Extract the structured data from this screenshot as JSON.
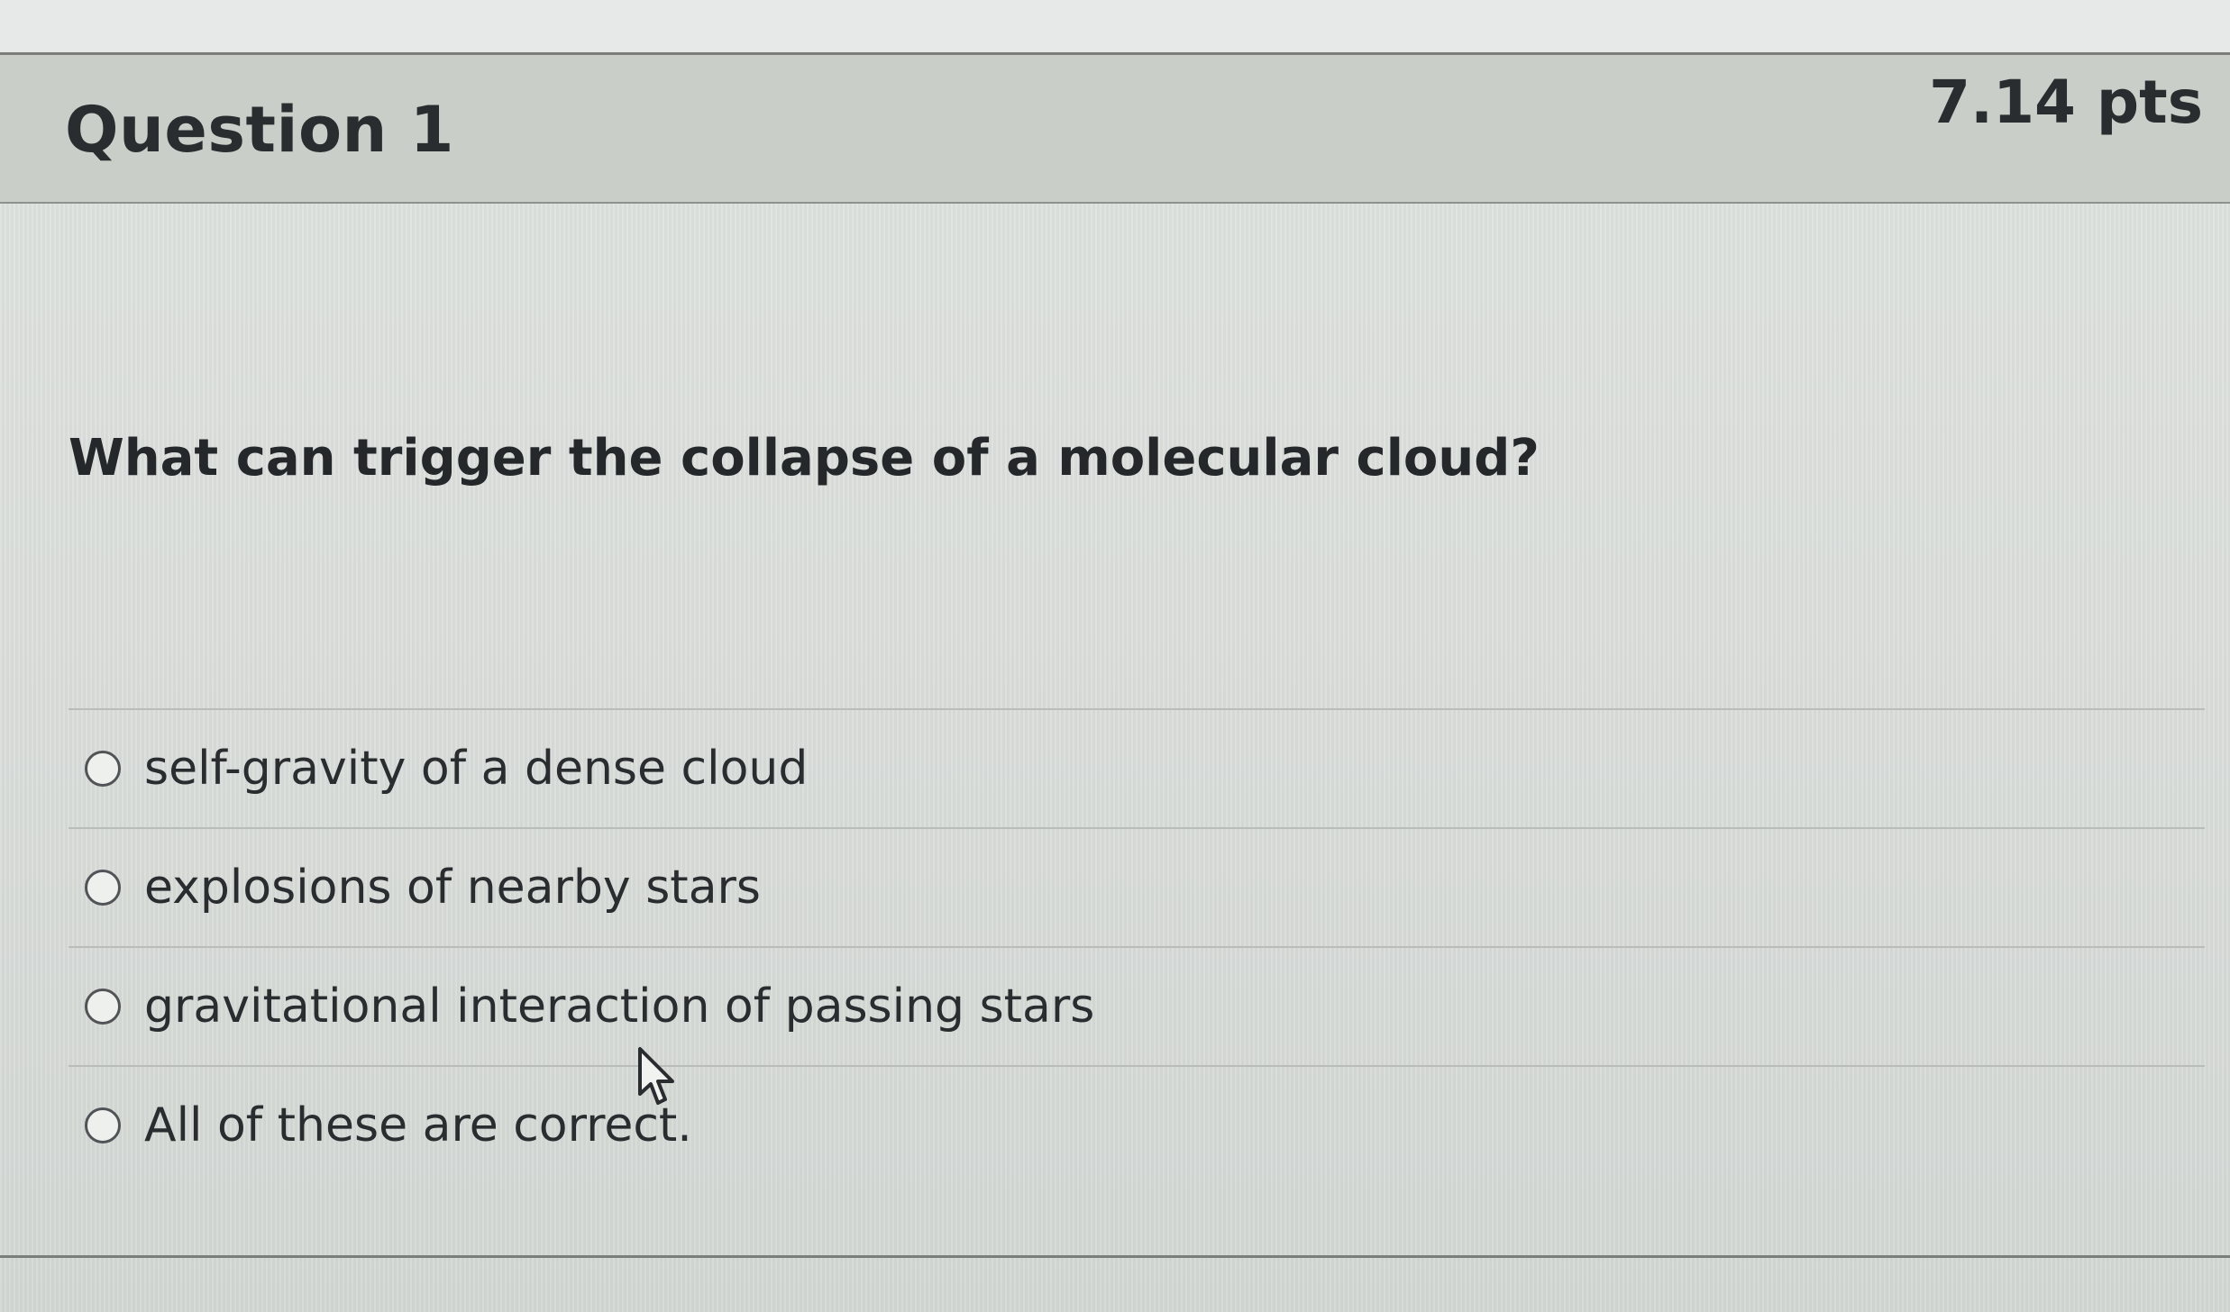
{
  "question": {
    "title": "Question 1",
    "points": "7.14 pts",
    "text": "What can trigger the collapse of a molecular cloud?"
  },
  "answers": [
    {
      "label": "self-gravity of a dense cloud",
      "selected": false
    },
    {
      "label": "explosions of nearby stars",
      "selected": false
    },
    {
      "label": "gravitational interaction of passing stars",
      "selected": false
    },
    {
      "label": "All of these are correct.",
      "selected": false
    }
  ],
  "icons": {
    "radio": "radio-button-icon",
    "cursor": "mouse-pointer-icon"
  }
}
